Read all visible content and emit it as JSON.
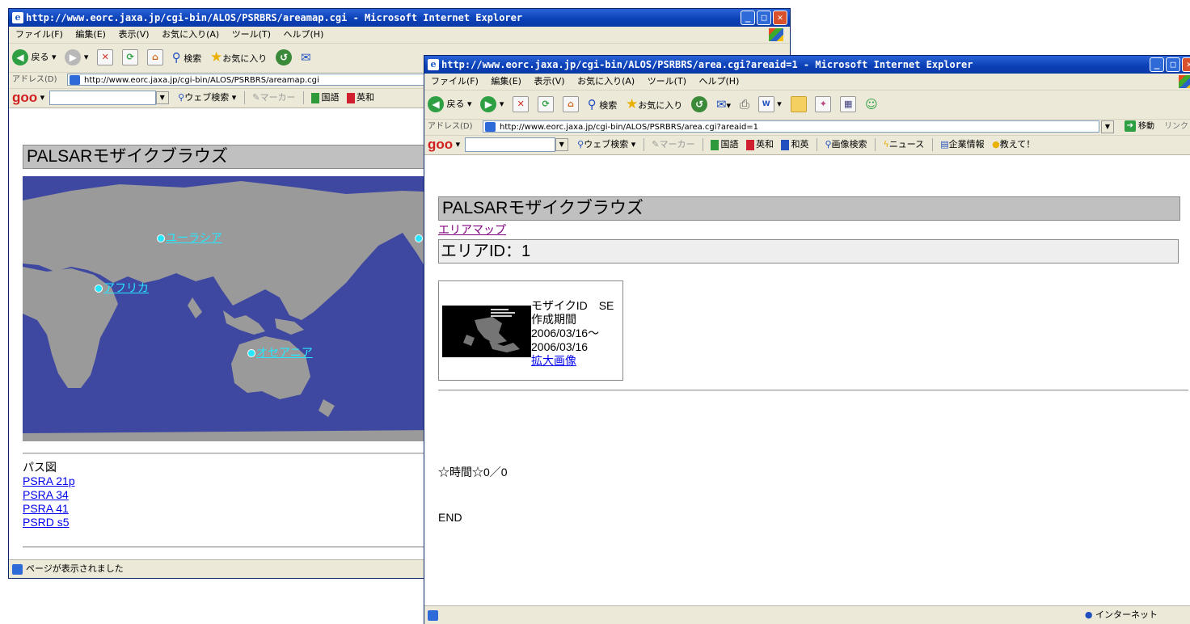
{
  "window1": {
    "title": "http://www.eorc.jaxa.jp/cgi-bin/ALOS/PSRBRS/areamap.cgi - Microsoft Internet Explorer",
    "menu": [
      "ファイル(F)",
      "編集(E)",
      "表示(V)",
      "お気に入り(A)",
      "ツール(T)",
      "ヘルプ(H)"
    ],
    "toolbar": {
      "back": "戻る",
      "search": "検索",
      "favorites": "お気に入り"
    },
    "address_label": "アドレス(D)",
    "address": "http://www.eorc.jaxa.jp/cgi-bin/ALOS/PSRBRS/areamap.cgi",
    "goo": {
      "logo": "goo",
      "web_search": "ウェブ検索",
      "marker": "マーカー",
      "kokugo": "国語",
      "eiwa": "英和"
    },
    "page_title": "PALSARモザイクブラウズ",
    "map_links": [
      "ユーラシア",
      "アフリカ",
      "オセアニア"
    ],
    "path_heading": "パス図",
    "path_links": [
      "PSRA 21p",
      "PSRA 34",
      "PSRA 41",
      "PSRD s5"
    ],
    "status": "ページが表示されました"
  },
  "window2": {
    "title": "http://www.eorc.jaxa.jp/cgi-bin/ALOS/PSRBRS/area.cgi?areaid=1 - Microsoft Internet Explorer",
    "menu": [
      "ファイル(F)",
      "編集(E)",
      "表示(V)",
      "お気に入り(A)",
      "ツール(T)",
      "ヘルプ(H)"
    ],
    "toolbar": {
      "back": "戻る",
      "search": "検索",
      "favorites": "お気に入り"
    },
    "address_label": "アドレス(D)",
    "address": "http://www.eorc.jaxa.jp/cgi-bin/ALOS/PSRBRS/area.cgi?areaid=1",
    "go_label": "移動",
    "links_label": "リンク",
    "goo": {
      "logo": "goo",
      "web_search": "ウェブ検索",
      "marker": "マーカー",
      "kokugo": "国語",
      "eiwa": "英和",
      "waei": "和英",
      "image_search": "画像検索",
      "news": "ニュース",
      "company": "企業情報",
      "oshiete": "教えて！"
    },
    "page_title": "PALSARモザイクブラウズ",
    "area_map_link": "エリアマップ",
    "area_heading": "エリアID：1",
    "mosaic": {
      "id_line": "モザイクID　SE",
      "period_label": "作成期間",
      "date_from": "2006/03/16～",
      "date_to": "2006/03/16",
      "enlarge_link": "拡大画像"
    },
    "time_text": "☆時間☆0／0",
    "end_text": "END",
    "status_zone": "インターネット"
  },
  "colors": {
    "titlebar": "#0a3fb5",
    "ocean": "#3e48a0",
    "land": "#9a9a9a",
    "map_link": "#27e6ff",
    "link": "#0000ee",
    "visited": "#800080"
  }
}
